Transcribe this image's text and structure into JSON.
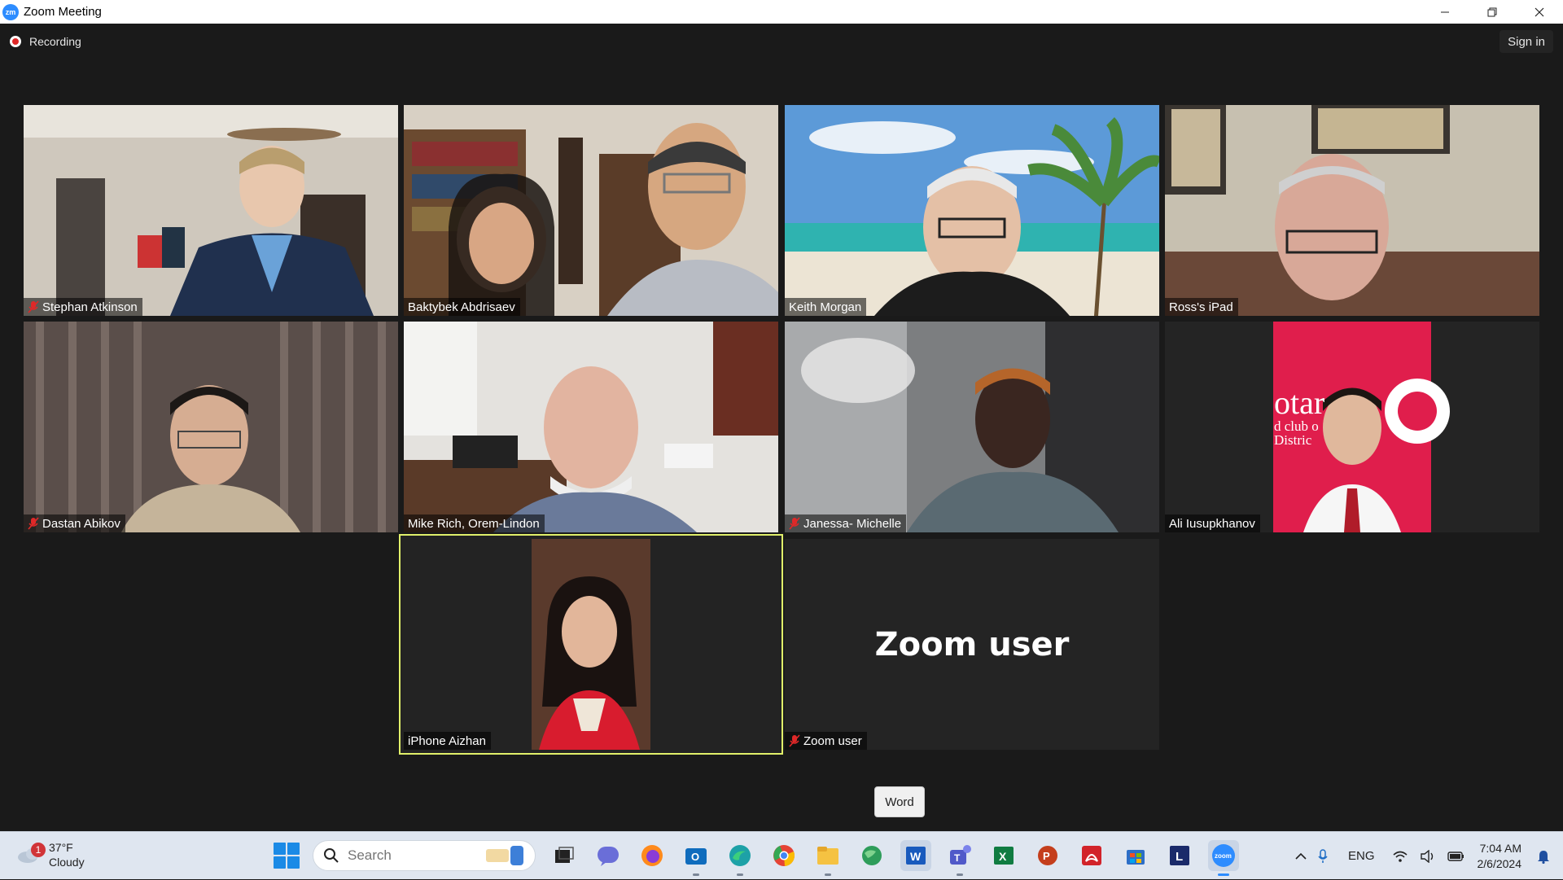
{
  "window": {
    "title": "Zoom Meeting",
    "app_icon": "zoom-logo",
    "app_icon_text": "zm"
  },
  "meeting": {
    "recording_label": "Recording",
    "sign_in_label": "Sign in",
    "participants": [
      {
        "name": "Stephan Atkinson",
        "muted": true
      },
      {
        "name": "Baktybek Abdrisaev",
        "muted": false
      },
      {
        "name": "Keith Morgan",
        "muted": false
      },
      {
        "name": "Ross's iPad",
        "muted": false
      },
      {
        "name": "Dastan Abikov",
        "muted": true
      },
      {
        "name": "Mike Rich, Orem-Lindon",
        "muted": false
      },
      {
        "name": "Janessa- Michelle",
        "muted": true
      },
      {
        "name": "Ali Iusupkhanov",
        "muted": false
      },
      {
        "name": "iPhone Aizhan",
        "muted": false,
        "active_speaker": true
      },
      {
        "name": "Zoom user",
        "muted": true,
        "display_name_large": "Zoom user"
      }
    ],
    "rotary_partial_text": [
      "otar",
      "d club o",
      "Distric"
    ]
  },
  "tooltip": "Word",
  "taskbar": {
    "weather": {
      "temp": "37°F",
      "condition": "Cloudy",
      "badge": "1"
    },
    "search_placeholder": "Search",
    "apps": [
      "task-view-icon",
      "teams-chat-icon",
      "firefox-icon",
      "outlook-icon",
      "edge-icon",
      "chrome-icon",
      "file-explorer-icon",
      "globe-icon",
      "word-icon",
      "teams-icon",
      "excel-icon",
      "powerpoint-icon",
      "acrobat-icon",
      "store-icon",
      "l-app-icon",
      "zoom-icon"
    ],
    "app_letters": {
      "word": "W",
      "excel": "X",
      "powerpoint": "P",
      "l_app": "L",
      "zoom": "zoom"
    },
    "language": "ENG",
    "time": "7:04 AM",
    "date": "2/6/2024"
  },
  "colors": {
    "active_speaker_border": "#e1f06a",
    "recording": "#e02828",
    "zoom_blue": "#2d8cff",
    "mute_red": "#e02828"
  }
}
